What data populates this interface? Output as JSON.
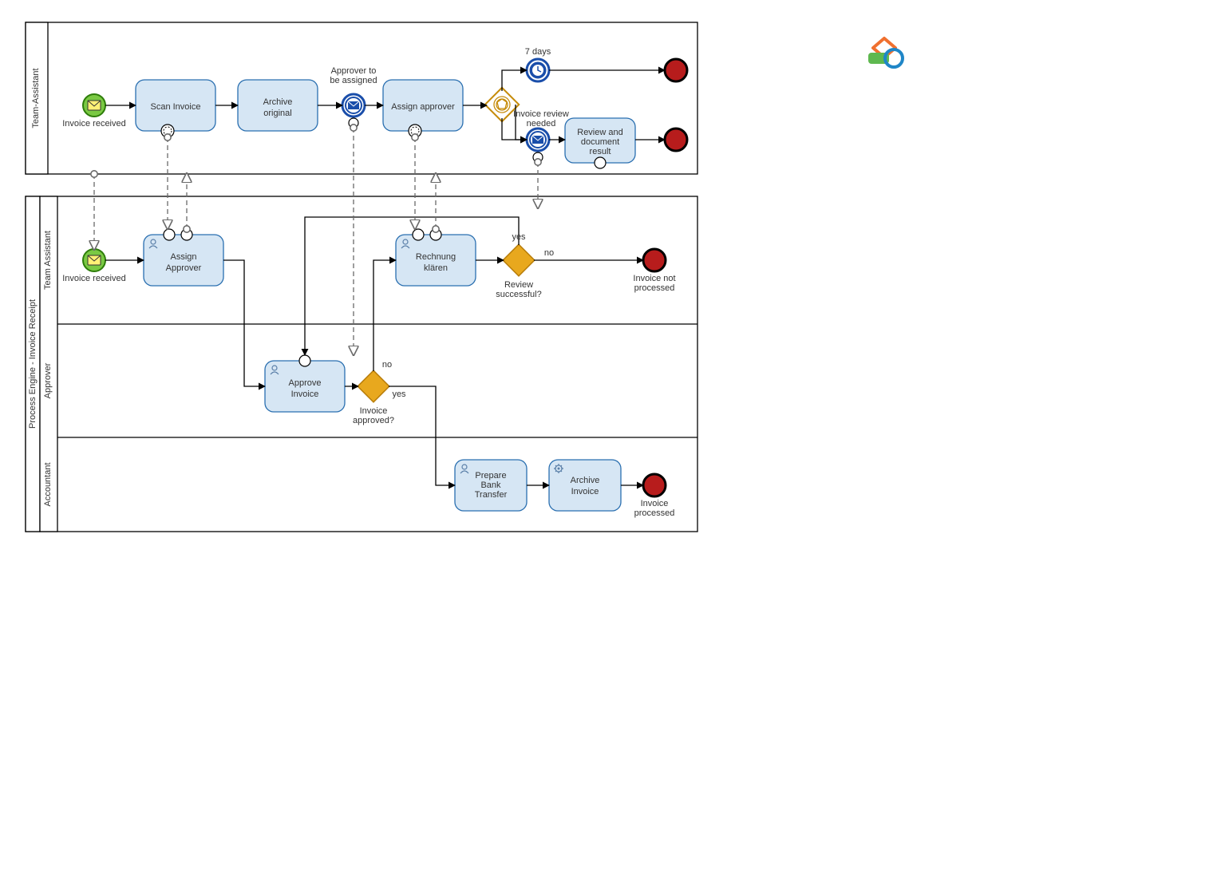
{
  "pool1": {
    "lane": "Team-Assistant"
  },
  "pool2": {
    "title": "Process Engine - Invoice Receipt",
    "lane1": "Team Assistant",
    "lane2": "Approver",
    "lane3": "Accountant"
  },
  "p1": {
    "start": "Invoice received",
    "scan": "Scan Invoice",
    "archive": "Archive original",
    "toAssign": "Approver to be assigned",
    "assign": "Assign approver",
    "timer": "7 days",
    "reviewNeeded": "Invoice review needed",
    "review": "Review and document result"
  },
  "p2": {
    "start": "Invoice received",
    "assignApprover": "Assign Approver",
    "clarify": "Rechnung klären",
    "reviewQ": "Review successful?",
    "notProcessed": "Invoice not processed",
    "approve": "Approve Invoice",
    "approveQ": "Invoice approved?",
    "prepare": "Prepare Bank Transfer",
    "archiveInv": "Archive Invoice",
    "processed": "Invoice processed"
  },
  "edges": {
    "yes": "yes",
    "no": "no"
  }
}
